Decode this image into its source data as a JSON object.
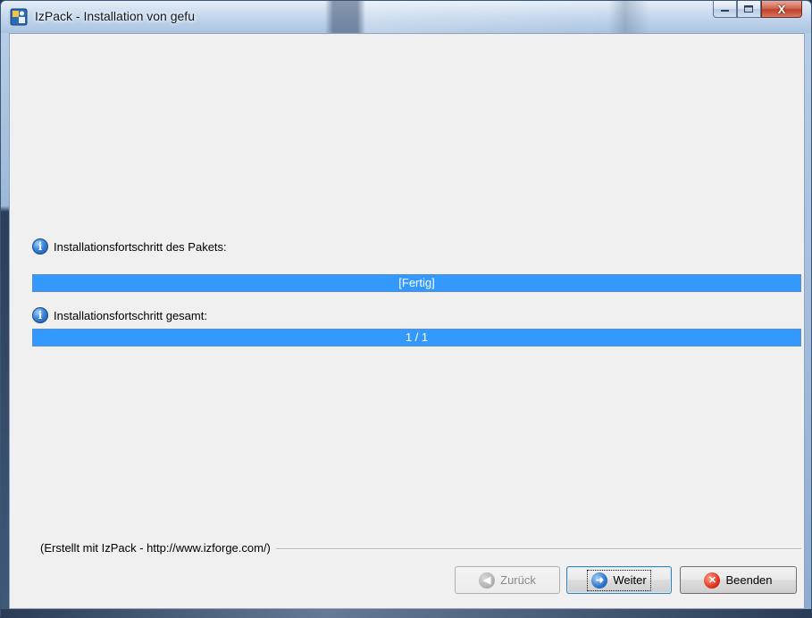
{
  "window": {
    "title": "IzPack - Installation von gefu",
    "icon": "izpack-app-icon",
    "controls": {
      "minimize": "minimize-icon",
      "maximize": "maximize-icon",
      "close_label": "X"
    }
  },
  "progress": {
    "pack_label": "Installationsfortschritt des Pakets:",
    "pack_text": "[Fertig]",
    "pack_percent": 100,
    "overall_label": "Installationsfortschritt gesamt:",
    "overall_text": "1 / 1",
    "overall_percent": 100,
    "bar_color": "#3399ff"
  },
  "footer": {
    "credit": "(Erstellt mit IzPack - http://www.izforge.com/)"
  },
  "buttons": {
    "back_label": "Zurück",
    "back_enabled": false,
    "next_label": "Weiter",
    "cancel_label": "Beenden"
  }
}
